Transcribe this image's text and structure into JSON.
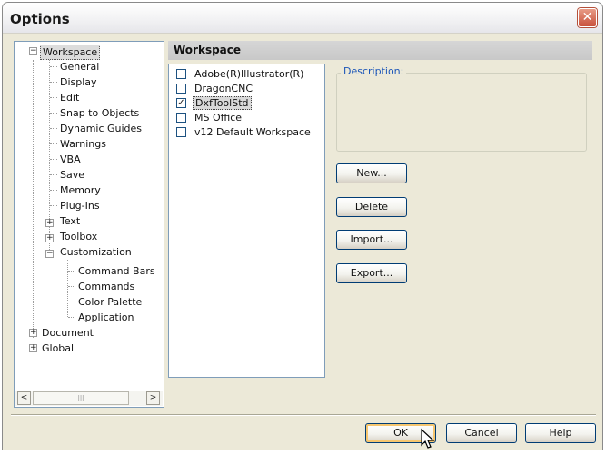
{
  "window": {
    "title": "Options",
    "close_label": "✕"
  },
  "tree": {
    "items": [
      {
        "label": "Workspace",
        "toggle": "−"
      },
      {
        "label": "General"
      },
      {
        "label": "Display"
      },
      {
        "label": "Edit"
      },
      {
        "label": "Snap to Objects"
      },
      {
        "label": "Dynamic Guides"
      },
      {
        "label": "Warnings"
      },
      {
        "label": "VBA"
      },
      {
        "label": "Save"
      },
      {
        "label": "Memory"
      },
      {
        "label": "Plug-Ins"
      },
      {
        "label": "Text",
        "toggle": "+"
      },
      {
        "label": "Toolbox",
        "toggle": "+"
      },
      {
        "label": "Customization",
        "toggle": "−"
      },
      {
        "label": "Command Bars"
      },
      {
        "label": "Commands"
      },
      {
        "label": "Color Palette"
      },
      {
        "label": "Application"
      },
      {
        "label": "Document",
        "toggle": "+"
      },
      {
        "label": "Global",
        "toggle": "+"
      }
    ],
    "scroll_left": "<",
    "scroll_right": ">",
    "scroll_grip": "III"
  },
  "pane": {
    "header": "Workspace",
    "workspaces": [
      {
        "label": "Adobe(R)Illustrator(R)",
        "checked": false
      },
      {
        "label": "DragonCNC",
        "checked": false
      },
      {
        "label": "DxfToolStd",
        "checked": true
      },
      {
        "label": "MS Office",
        "checked": false
      },
      {
        "label": "v12 Default Workspace",
        "checked": false
      }
    ],
    "description_label": "Description:",
    "buttons": {
      "new": "New...",
      "delete": "Delete",
      "import": "Import...",
      "export": "Export..."
    }
  },
  "footer": {
    "ok": "OK",
    "cancel": "Cancel",
    "help": "Help"
  },
  "colors": {
    "window_bg": "#ece9d8",
    "border_blue": "#7f9db9",
    "accent_blue": "#1c56b8",
    "close_red": "#c8513b"
  }
}
